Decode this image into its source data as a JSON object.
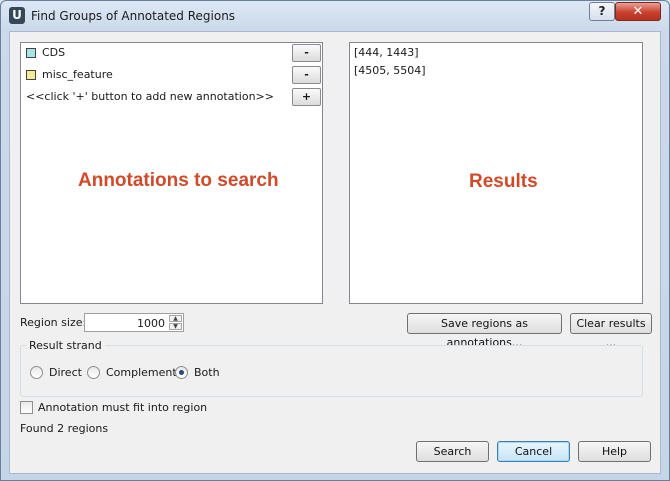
{
  "window": {
    "title": "Find Groups of Annotated Regions",
    "app_icon_letter": "U",
    "help_symbol": "?",
    "close_symbol": "✕"
  },
  "annotations": {
    "items": [
      {
        "name": "CDS",
        "color": "#a6e3ea",
        "remove_label": "-"
      },
      {
        "name": "misc_feature",
        "color": "#f3eb96",
        "remove_label": "-"
      }
    ],
    "hint": "<<click '+' button to add new annotation>>",
    "add_label": "+",
    "overlay": "Annotations to search"
  },
  "results": {
    "items": [
      "[444, 1443]",
      "[4505, 5504]"
    ],
    "overlay": "Results"
  },
  "region_size": {
    "label": "Region size:",
    "value": "1000"
  },
  "buttons": {
    "save_regions": "Save regions as annotations...",
    "clear_results": "Clear results ...",
    "search": "Search",
    "cancel": "Cancel",
    "help": "Help"
  },
  "strand": {
    "title": "Result strand",
    "options": [
      "Direct",
      "Complement",
      "Both"
    ],
    "selected": "Both"
  },
  "fit_checkbox": {
    "label": "Annotation must fit into region",
    "checked": false
  },
  "status": "Found 2 regions"
}
